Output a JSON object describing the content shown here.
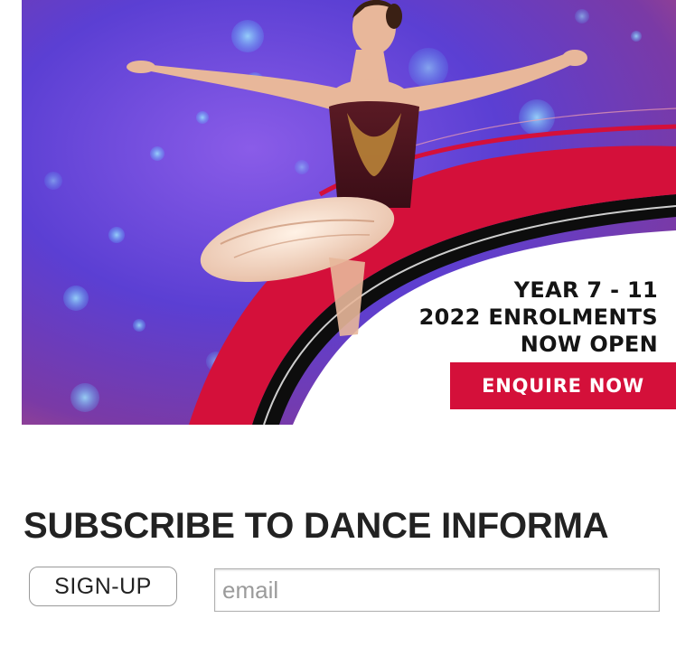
{
  "ad": {
    "headline": [
      "YEAR 7 - 11",
      "2022 ENROLMENTS",
      "NOW OPEN"
    ],
    "cta_label": "ENQUIRE NOW",
    "colors": {
      "accent": "#d4103a",
      "backdrop": "#5a3fd0",
      "text": "#141414"
    }
  },
  "subscribe": {
    "title": "SUBSCRIBE TO DANCE INFORMA",
    "button_label": "SIGN-UP",
    "email_placeholder": "email",
    "email_value": ""
  },
  "icons": [
    "ballet-dancer-photo"
  ]
}
